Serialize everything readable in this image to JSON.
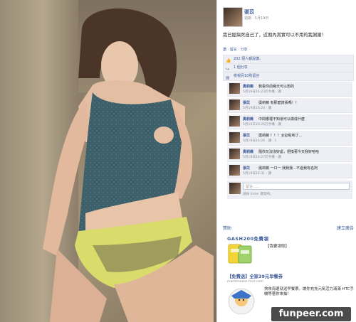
{
  "post": {
    "author": "張苡",
    "meta": "週期 · 5月19日 ",
    "text": "我已經搞死自己了，近期內其實可以不用的我謝謝！",
    "actions": "讚 · 留言 · 分享"
  },
  "likes": {
    "like_count": "202 個人都說讚。",
    "share_count": "1 個分享",
    "view_more": "檢視另10則留言"
  },
  "comments": [
    {
      "name": "奧莉薇",
      "text": "我看你前幾天可以想的",
      "meta": "5月19日16:23於手機 · 讚"
    },
    {
      "name": "張苡",
      "text": "奧莉薇 有那麼誇張嗎！！",
      "meta": "5月19日16:24 · 讚"
    },
    {
      "name": "奧莉薇",
      "text": "中間哪裡不知道可以做成什麼",
      "meta": "5月19日16:25於手機 · 讚"
    },
    {
      "name": "張苡",
      "text": "奧莉薇 ！！！太扯啦吧了…",
      "meta": "5月19日16:26 · 讚 · 1"
    },
    {
      "name": "奧莉薇",
      "text": "隨你又沒沒好處，把換著今天我好哈哈",
      "meta": "5月19日16:27於手機 · 讚"
    },
    {
      "name": "張苡",
      "text": "奧莉薇 一口一 我我我…不過我有名阿",
      "meta": "5月19日16:31 · 讚"
    }
  ],
  "comment_input": {
    "placeholder": "留言……",
    "hint": "請按 Enter 鍵發布。"
  },
  "ads": {
    "header_left": "贊助",
    "header_right": "建立廣告",
    "ad1": {
      "title": "GASH200免費領",
      "desc": "【我要領取】"
    },
    "ad2": {
      "title": "【免費送】全家39元早餐券",
      "url": "mantimeans.hicir.com",
      "desc": "快來海選就送早餐票。讓你充充元氣活力滿滿 HTC手機等著你來抽！"
    }
  },
  "watermark": "funpeer.com"
}
